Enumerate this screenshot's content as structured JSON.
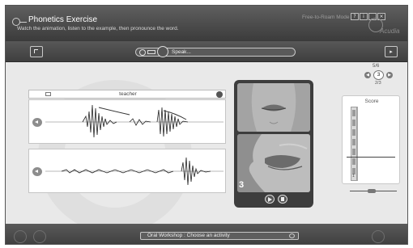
{
  "window": {
    "title": "Phonetics Exercise",
    "subtitle": "Watch the animation, listen to the example, then pronounce the word.",
    "mode": "Free-to-Roam Mode",
    "buttons": [
      "?",
      "i",
      "_",
      "×"
    ]
  },
  "toolbar": {
    "speak_label": "Speak..."
  },
  "progress": {
    "count": "5/6"
  },
  "variant": {
    "current": "3",
    "count": "2/3"
  },
  "waveform": {
    "header_label": "teacher"
  },
  "face": {
    "step_number": "3"
  },
  "score": {
    "label": "Score",
    "value": "1",
    "segments_filled": 7,
    "level_fraction": 0.2
  },
  "bottom": {
    "activity_label": "Oral Workshop : Choose an activity"
  },
  "icons": {
    "menu": "menu-icon",
    "next": "next-arrow-icon",
    "record": "record-icon",
    "mic": "mic-icon",
    "speaker": "speaker-icon",
    "play": "play-icon",
    "stop": "stop-icon"
  }
}
